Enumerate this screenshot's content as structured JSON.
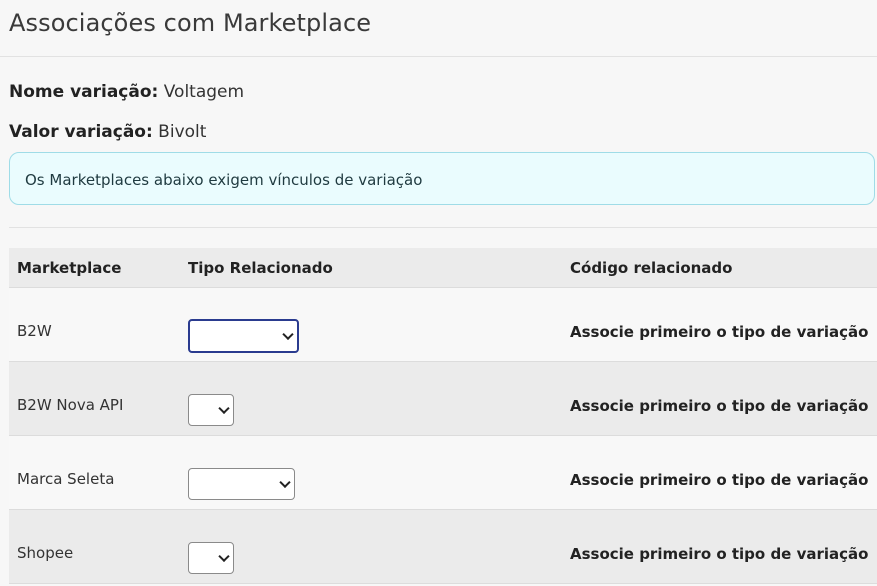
{
  "page": {
    "title": "Associações com Marketplace"
  },
  "info": {
    "nome_label": "Nome variação:",
    "nome_value": " Voltagem",
    "valor_label": "Valor variação:",
    "valor_value": " Bivolt"
  },
  "alert": {
    "text": "Os Marketplaces abaixo exigem vínculos de variação"
  },
  "table": {
    "headers": [
      "Marketplace",
      "Tipo Relacionado",
      "Código relacionado"
    ],
    "rows": [
      {
        "marketplace": "B2W",
        "tipo_selected": "",
        "codigo": "Associe primeiro o tipo de variação"
      },
      {
        "marketplace": "B2W Nova API",
        "tipo_selected": "",
        "codigo": "Associe primeiro o tipo de variação"
      },
      {
        "marketplace": "Marca Seleta",
        "tipo_selected": "",
        "codigo": "Associe primeiro o tipo de variação"
      },
      {
        "marketplace": "Shopee",
        "tipo_selected": "",
        "codigo": "Associe primeiro o tipo de variação"
      }
    ]
  },
  "icons": {
    "select_arrow": "chevron-down-icon"
  },
  "colors": {
    "alert_bg": "#eafcfe",
    "alert_border": "#9fdce7",
    "focus_border": "#2a3b8f"
  }
}
